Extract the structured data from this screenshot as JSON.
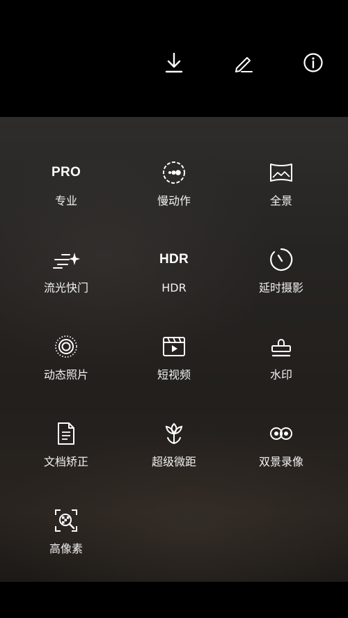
{
  "toolbar": {
    "download_icon": "download-icon",
    "edit_icon": "edit-icon",
    "info_icon": "info-icon"
  },
  "modes": [
    {
      "id": "pro",
      "label": "专业",
      "icon": "PRO"
    },
    {
      "id": "slow-motion",
      "label": "慢动作",
      "icon": "slow-motion-icon"
    },
    {
      "id": "panorama",
      "label": "全景",
      "icon": "panorama-icon"
    },
    {
      "id": "light-painting",
      "label": "流光快门",
      "icon": "light-streak-icon"
    },
    {
      "id": "hdr",
      "label": "HDR",
      "icon": "HDR"
    },
    {
      "id": "time-lapse",
      "label": "延时摄影",
      "icon": "timer-icon"
    },
    {
      "id": "moving-picture",
      "label": "动态照片",
      "icon": "live-photo-icon"
    },
    {
      "id": "short-video",
      "label": "短视频",
      "icon": "video-clip-icon"
    },
    {
      "id": "watermark",
      "label": "水印",
      "icon": "stamp-icon"
    },
    {
      "id": "document",
      "label": "文档矫正",
      "icon": "document-icon"
    },
    {
      "id": "super-macro",
      "label": "超级微距",
      "icon": "flower-icon"
    },
    {
      "id": "dual-view",
      "label": "双景录像",
      "icon": "dual-view-icon"
    },
    {
      "id": "high-res",
      "label": "高像素",
      "icon": "high-res-icon"
    }
  ],
  "colors": {
    "background": "#000000",
    "panel": "#262422",
    "text": "#ffffff"
  }
}
